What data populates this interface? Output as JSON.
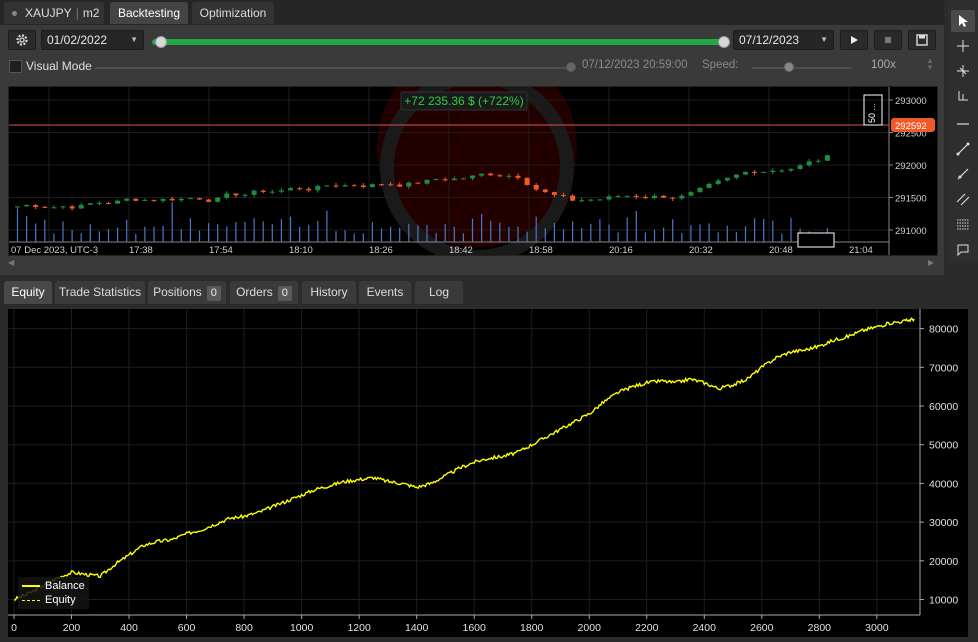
{
  "top_tabs": {
    "symbol": "XAUJPY",
    "timeframe": "m2",
    "backtesting": "Backtesting",
    "optimization": "Optimization"
  },
  "controls": {
    "start_date": "01/02/2022",
    "end_date": "07/12/2023",
    "visual_mode_label": "Visual Mode",
    "current_time": "07/12/2023 20:59:00",
    "speed_label": "Speed:",
    "speed_value": "100x",
    "progress": 1.0,
    "accent_color": "#22a845"
  },
  "price_chart": {
    "profit_label": "+72 235.36 $ (+722%)",
    "current_price": "292592",
    "scale_marker": "50 ...",
    "price_ticks": [
      "293000",
      "292500",
      "292000",
      "291500",
      "291000"
    ],
    "time_ticks": [
      "07 Dec 2023, UTC-3",
      "17:38",
      "17:54",
      "18:10",
      "18:26",
      "18:42",
      "18:58",
      "20:16",
      "20:32",
      "20:48",
      "21:04"
    ],
    "bull_color": "#1e8e3e",
    "bear_color": "#f05a28"
  },
  "bottom_tabs": {
    "equity": "Equity",
    "trade_statistics": "Trade Statistics",
    "positions": "Positions",
    "positions_count": "0",
    "orders": "Orders",
    "orders_count": "0",
    "history": "History",
    "events": "Events",
    "log": "Log"
  },
  "chart_data": {
    "type": "line",
    "xlabel": "",
    "ylabel": "",
    "xlim": [
      0,
      3150
    ],
    "ylim": [
      6000,
      83000
    ],
    "x_ticks": [
      0,
      200,
      400,
      600,
      800,
      1000,
      1200,
      1400,
      1600,
      1800,
      2000,
      2200,
      2400,
      2600,
      2800,
      3000
    ],
    "y_ticks": [
      10000,
      20000,
      30000,
      40000,
      50000,
      60000,
      70000,
      80000
    ],
    "grid": true,
    "legend_position": "bottom-left",
    "series": [
      {
        "name": "Balance",
        "color": "#ffff00",
        "x": [
          0,
          50,
          100,
          150,
          200,
          250,
          300,
          350,
          400,
          450,
          500,
          550,
          600,
          650,
          700,
          750,
          800,
          850,
          900,
          950,
          1000,
          1050,
          1100,
          1150,
          1200,
          1250,
          1300,
          1350,
          1400,
          1450,
          1500,
          1550,
          1600,
          1650,
          1700,
          1750,
          1800,
          1850,
          1900,
          1950,
          2000,
          2050,
          2100,
          2150,
          2200,
          2250,
          2300,
          2350,
          2400,
          2450,
          2500,
          2550,
          2600,
          2650,
          2700,
          2750,
          2800,
          2850,
          2900,
          2950,
          3000,
          3050,
          3100,
          3130
        ],
        "values": [
          10000,
          11500,
          13500,
          15500,
          17000,
          16500,
          16000,
          19000,
          21500,
          24000,
          25000,
          25500,
          27000,
          28000,
          29500,
          31000,
          31500,
          32500,
          34000,
          35500,
          37000,
          38500,
          39500,
          40500,
          41000,
          41500,
          40500,
          40000,
          39000,
          40000,
          42000,
          44000,
          45500,
          46500,
          47000,
          48000,
          50000,
          52000,
          54000,
          56000,
          58000,
          61000,
          63500,
          65000,
          66000,
          66500,
          66000,
          67000,
          66000,
          64500,
          65500,
          67000,
          70000,
          72500,
          74000,
          74500,
          75500,
          77000,
          78000,
          79500,
          80500,
          81500,
          82000,
          82500
        ]
      },
      {
        "name": "Equity",
        "color": "#ffff00",
        "x": [],
        "values": []
      }
    ]
  }
}
